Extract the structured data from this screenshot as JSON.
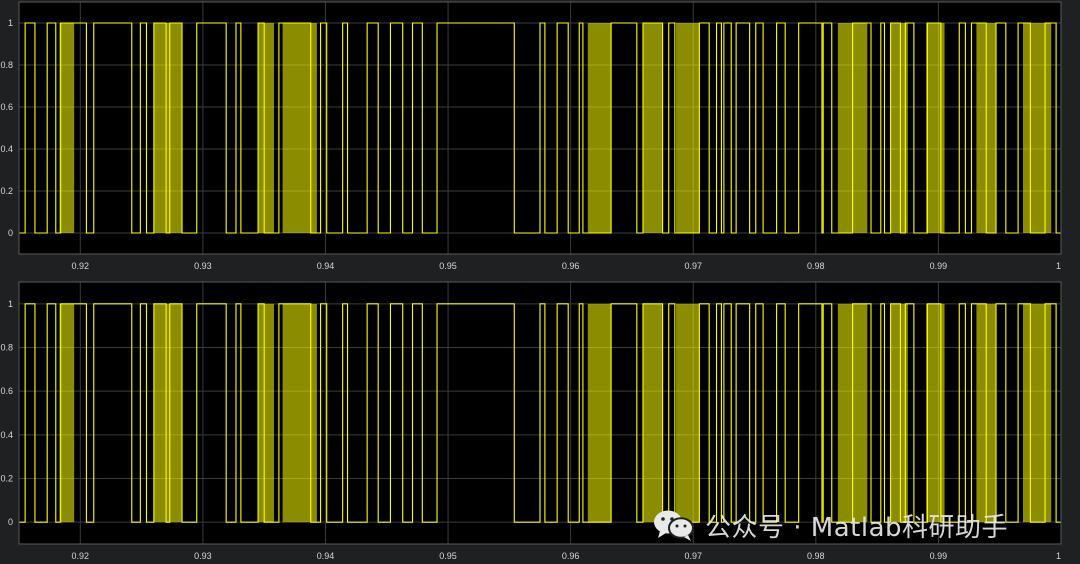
{
  "chart_data": [
    {
      "type": "line",
      "step": true,
      "xlim": [
        0.915,
        1.0
      ],
      "ylim": [
        -0.1,
        1.1
      ],
      "x_ticks": [
        "0.92",
        "0.93",
        "0.94",
        "0.95",
        "0.96",
        "0.97",
        "0.98",
        "0.99",
        "1"
      ],
      "y_ticks": [
        "0",
        "0.2",
        "0.4",
        "0.6",
        "0.8",
        "1"
      ],
      "grid": true,
      "background": "#000000",
      "line_color": "#ffff00",
      "series": [
        {
          "x": [
            0.9155,
            0.9163,
            0.9173,
            0.918,
            0.9184,
            0.9205,
            0.9211,
            0.9242,
            0.9249,
            0.9254,
            0.926,
            0.927,
            0.9273,
            0.9283,
            0.9295,
            0.9319,
            0.9327,
            0.9331,
            0.9345,
            0.935,
            0.9362,
            0.9388,
            0.9396,
            0.9401,
            0.9414,
            0.9418,
            0.9434,
            0.9443,
            0.9453,
            0.9463,
            0.9471,
            0.9479,
            0.9491,
            0.9554,
            0.9575,
            0.9579,
            0.9589,
            0.9598,
            0.9607,
            0.961,
            0.9633,
            0.9654,
            0.9659,
            0.9675,
            0.968,
            0.9685,
            0.9705,
            0.9713,
            0.9719,
            0.9723,
            0.9725,
            0.9731,
            0.9735,
            0.9746,
            0.9751,
            0.9757,
            0.9768,
            0.9775,
            0.9786,
            0.9805,
            0.9806,
            0.9813,
            0.983,
            0.9845,
            0.9853,
            0.9856,
            0.9861,
            0.9869,
            0.9873,
            0.988,
            0.9891,
            0.9902,
            0.9917,
            0.9922,
            0.9927,
            0.9939,
            0.9947,
            0.9955,
            0.9965,
            0.9975,
            0.9987,
            0.9996
          ],
          "y": [
            1,
            0,
            1,
            0,
            1,
            0,
            1,
            0,
            1,
            0,
            1,
            0,
            1,
            0,
            1,
            0,
            1,
            0,
            1,
            0,
            1,
            0,
            1,
            0,
            1,
            0,
            1,
            0,
            1,
            0,
            1,
            0,
            1,
            0,
            1,
            0,
            1,
            0,
            1,
            0,
            1,
            0,
            1,
            0,
            1,
            0,
            1,
            0,
            1,
            0,
            1,
            0,
            1,
            0,
            1,
            0,
            1,
            0,
            1,
            0,
            1,
            0,
            1,
            0,
            1,
            0,
            1,
            0,
            1,
            0,
            1,
            0,
            1,
            0,
            1,
            0,
            1,
            0,
            1,
            0,
            1,
            0
          ],
          "dense_ranges": [
            [
              0.9183,
              0.9195
            ],
            [
              0.926,
              0.9283
            ],
            [
              0.9345,
              0.9358
            ],
            [
              0.9365,
              0.9393
            ],
            [
              0.9614,
              0.9633
            ],
            [
              0.9659,
              0.9675
            ],
            [
              0.9686,
              0.9705
            ],
            [
              0.9818,
              0.9842
            ],
            [
              0.9861,
              0.9875
            ],
            [
              0.989,
              0.9905
            ],
            [
              0.9931,
              0.9947
            ],
            [
              0.9969,
              0.9992
            ]
          ]
        }
      ]
    },
    {
      "type": "line",
      "step": true,
      "xlim": [
        0.915,
        1.0
      ],
      "ylim": [
        -0.1,
        1.1
      ],
      "x_ticks": [
        "0.92",
        "0.93",
        "0.94",
        "0.95",
        "0.96",
        "0.97",
        "0.98",
        "0.99",
        "1"
      ],
      "y_ticks": [
        "0",
        "0.2",
        "0.4",
        "0.6",
        "0.8",
        "1"
      ],
      "grid": true,
      "background": "#000000",
      "line_color": "#ffff00",
      "series": [
        {
          "x": [
            0.9155,
            0.9163,
            0.9173,
            0.918,
            0.9184,
            0.9205,
            0.9211,
            0.9242,
            0.9249,
            0.9254,
            0.926,
            0.927,
            0.9273,
            0.9283,
            0.9295,
            0.9319,
            0.9327,
            0.9331,
            0.9345,
            0.935,
            0.9362,
            0.9388,
            0.9396,
            0.9401,
            0.9414,
            0.9418,
            0.9434,
            0.9443,
            0.9453,
            0.9463,
            0.9471,
            0.9479,
            0.9491,
            0.9554,
            0.9575,
            0.9579,
            0.9589,
            0.9598,
            0.9607,
            0.961,
            0.9633,
            0.9654,
            0.9659,
            0.9675,
            0.968,
            0.9685,
            0.9705,
            0.9713,
            0.9719,
            0.9723,
            0.9725,
            0.9731,
            0.9735,
            0.9746,
            0.9751,
            0.9757,
            0.9768,
            0.9775,
            0.9786,
            0.9805,
            0.9806,
            0.9813,
            0.983,
            0.9845,
            0.9853,
            0.9856,
            0.9861,
            0.9869,
            0.9873,
            0.988,
            0.9891,
            0.9902,
            0.9917,
            0.9922,
            0.9927,
            0.9939,
            0.9947,
            0.9955,
            0.9965,
            0.9975,
            0.9987,
            0.9996
          ],
          "y": [
            1,
            0,
            1,
            0,
            1,
            0,
            1,
            0,
            1,
            0,
            1,
            0,
            1,
            0,
            1,
            0,
            1,
            0,
            1,
            0,
            1,
            0,
            1,
            0,
            1,
            0,
            1,
            0,
            1,
            0,
            1,
            0,
            1,
            0,
            1,
            0,
            1,
            0,
            1,
            0,
            1,
            0,
            1,
            0,
            1,
            0,
            1,
            0,
            1,
            0,
            1,
            0,
            1,
            0,
            1,
            0,
            1,
            0,
            1,
            0,
            1,
            0,
            1,
            0,
            1,
            0,
            1,
            0,
            1,
            0,
            1,
            0,
            1,
            0,
            1,
            0,
            1,
            0,
            1,
            0,
            1,
            0
          ],
          "dense_ranges": [
            [
              0.9183,
              0.9195
            ],
            [
              0.926,
              0.9283
            ],
            [
              0.9345,
              0.9358
            ],
            [
              0.9365,
              0.9393
            ],
            [
              0.9614,
              0.9633
            ],
            [
              0.9659,
              0.9675
            ],
            [
              0.9686,
              0.9705
            ],
            [
              0.9818,
              0.9842
            ],
            [
              0.9861,
              0.9875
            ],
            [
              0.989,
              0.9905
            ],
            [
              0.9931,
              0.9947
            ],
            [
              0.9969,
              0.9992
            ]
          ]
        }
      ]
    }
  ],
  "watermark": {
    "text": "公众号 · Matlab科研助手",
    "icon": "wechat-icon"
  }
}
